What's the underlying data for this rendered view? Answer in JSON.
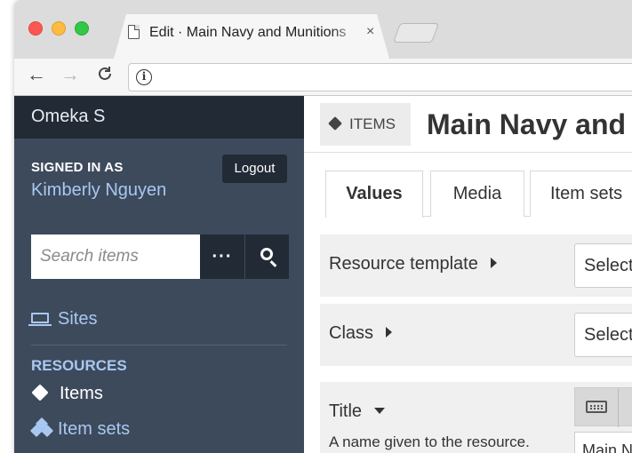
{
  "browser": {
    "tab_title": "Edit · Main Navy and Munitions",
    "tab_close": "×",
    "nav_back": "←",
    "nav_forward": "→",
    "nav_reload": "C",
    "info_glyph": "i"
  },
  "sidebar": {
    "brand": "Omeka S",
    "signed_in_label": "SIGNED IN AS",
    "user_name": "Kimberly Nguyen",
    "logout_label": "Logout",
    "search_placeholder": "Search items",
    "advanced_label": "···",
    "sites_label": "Sites",
    "resources_label": "RESOURCES",
    "items_label": "Items",
    "item_sets_label": "Item sets"
  },
  "main": {
    "badge_label": "ITEMS",
    "page_title": "Main Navy and Munitions",
    "tabs": [
      {
        "label": "Values"
      },
      {
        "label": "Media"
      },
      {
        "label": "Item sets"
      }
    ],
    "fields": {
      "resource_template": {
        "label": "Resource template",
        "select_value": "Select"
      },
      "class": {
        "label": "Class",
        "select_value": "Select"
      },
      "title": {
        "label": "Title",
        "description": "A name given to the resource.",
        "value": "Main Navy and Munitions"
      }
    }
  },
  "colors": {
    "sidebar_bg": "#3d4a5c",
    "sidebar_header_bg": "#222a35",
    "link_blue": "#a9c8f0"
  }
}
